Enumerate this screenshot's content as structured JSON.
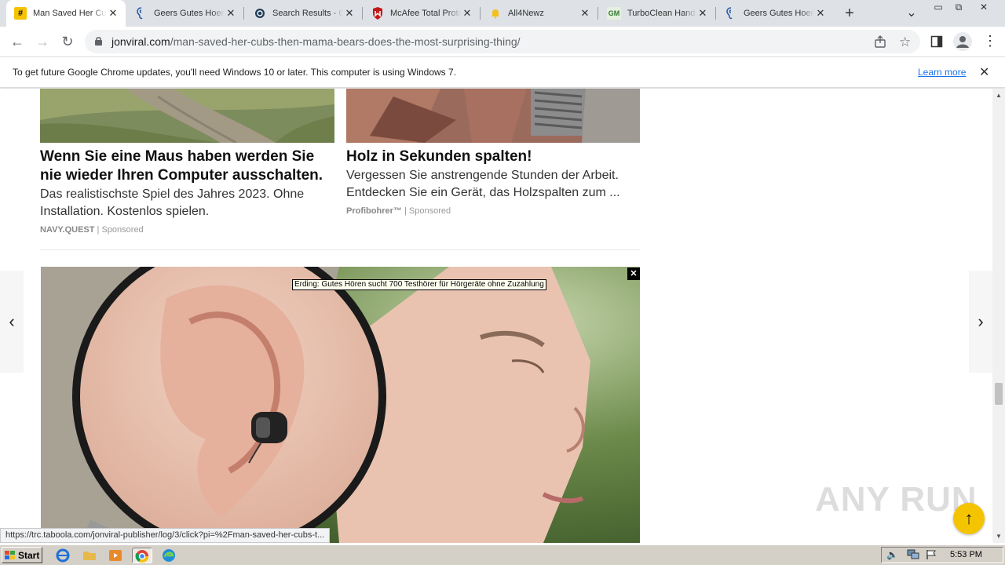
{
  "browser": {
    "tabs": [
      {
        "title": "Man Saved Her Cubs Then Mama Bears Does The Most Surprising Thing",
        "favicon": "hash-icon",
        "active": true
      },
      {
        "title": "Geers Gutes Hoeren",
        "favicon": "hearing-icon",
        "active": false
      },
      {
        "title": "Search Results - Chrome",
        "favicon": "search-globe-icon",
        "active": false
      },
      {
        "title": "McAfee Total Protection",
        "favicon": "mcafee-shield-icon",
        "active": false
      },
      {
        "title": "All4Newz",
        "favicon": "bell-icon",
        "active": false
      },
      {
        "title": "TurboClean Handsfree",
        "favicon": "gm-icon",
        "active": false
      },
      {
        "title": "Geers Gutes Hoeren",
        "favicon": "hearing-icon",
        "active": false
      }
    ],
    "new_tab_symbol": "+",
    "tab_close_symbol": "✕",
    "tab_search_symbol": "⌄",
    "window_controls": {
      "minimize": "▭",
      "restore": "⧉",
      "close": "✕"
    },
    "address": {
      "host": "jonviral.com",
      "path": "/man-saved-her-cubs-then-mama-bears-does-the-most-surprising-thing/"
    },
    "nav": {
      "back": "←",
      "forward": "→",
      "reload": "↻"
    },
    "infobar": {
      "message": "To get future Google Chrome updates, you'll need Windows 10 or later. This computer is using Windows 7.",
      "learn_more": "Learn more",
      "close": "✕"
    },
    "status_url": "https://trc.taboola.com/jonviral-publisher/log/3/click?pi=%2Fman-saved-her-cubs-t..."
  },
  "page": {
    "cards": [
      {
        "headline": "Wenn Sie eine Maus haben werden Sie nie wieder Ihren Computer ausschalten.",
        "description": "Das realistischste Spiel des Jahres 2023. Ohne Installation. Kostenlos spielen.",
        "brand": "NAVY.QUEST",
        "sponsored": "Sponsored"
      },
      {
        "headline": "Holz in Sekunden spalten!",
        "description": "Vergessen Sie anstrengende Stunden der Arbeit. Entdecken Sie ein Gerät, das Holzspalten zum ...",
        "brand": "Profibohrer™",
        "sponsored": "Sponsored"
      }
    ],
    "big_ad": {
      "tooltip": "Erding: Gutes Hören sucht 700 Testhörer für Hörgeräte ohne Zuzahlung",
      "close": "✕"
    },
    "arrows": {
      "left": "‹",
      "right": "›"
    },
    "scroll_top": "↑",
    "watermark": "ANY RUN"
  },
  "taskbar": {
    "start_label": "Start",
    "clock": "5:53 PM",
    "colors": {
      "taskbar": "#d4d0c8",
      "start_logo": "#2e8b3a"
    }
  }
}
